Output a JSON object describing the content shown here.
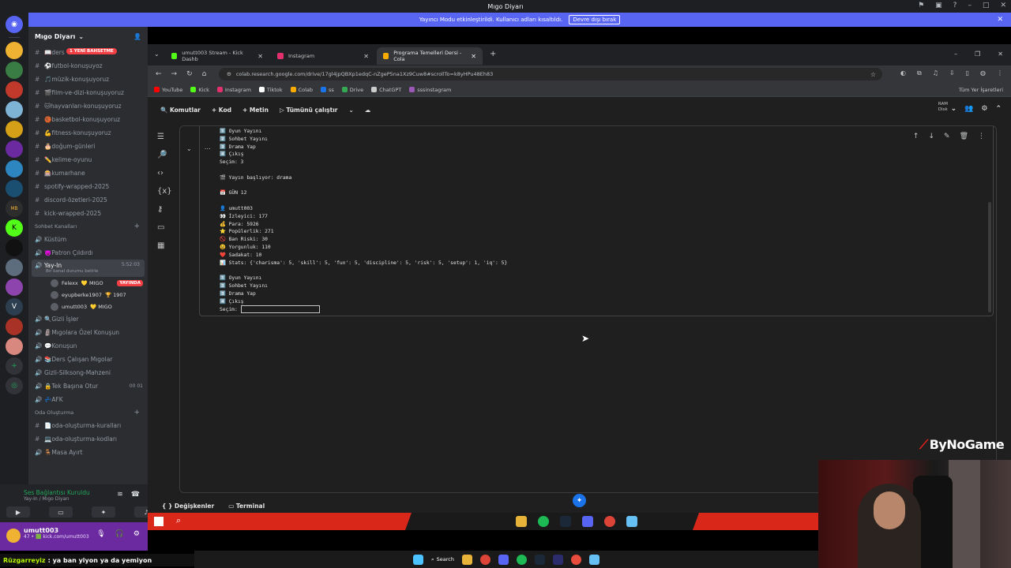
{
  "window": {
    "title": "Mıgo Diyarı"
  },
  "banner": {
    "text": "Yayıncı Modu etkinleştirildi. Kullanıcı adları kısaltıldı.",
    "button": "Devre dışı bırak"
  },
  "sidebar": {
    "server_name": "Mıgo Diyarı",
    "new_messages_badge": "1 YENİ BAHSETME",
    "channels": [
      "📖ders",
      "⚽futbol-konuşuyoz",
      "🎵müzik-konuşuyoruz",
      "🎬film-ve-dizi-konuşuyoruz",
      "🐱hayvanları-konuşuyoruz",
      "🏀basketbol-konuşuyoruz",
      "💪fitness-konuşuyoruz",
      "🎂doğum-günleri",
      "✏️kelime-oyunu",
      "🎰kumarhane",
      "spotify-wrapped-2025",
      "discord-özetleri-2025",
      "kick-wrapped-2025"
    ],
    "category_voice": "Sohbet Kanalları",
    "voice_channels_top": [
      "Küstüm",
      "👿Patron Çıldırdı"
    ],
    "active_voice": {
      "name": "Yay-In",
      "time": "5:52:03",
      "status": "Bir kanal durumu belirle"
    },
    "voice_users": [
      {
        "name": "Felexx",
        "tag": "💛 MIGO",
        "live": "YAYINDA"
      },
      {
        "name": "eyupberke1907",
        "tag": "🏆 1907",
        "live": ""
      },
      {
        "name": "umutt003",
        "tag": "💛 MIGO",
        "live": ""
      }
    ],
    "voice_channels_bottom": [
      "🔍Gizli İşler",
      "🗿Mıgolara Özel Konuşun",
      "💬Konuşun",
      "📚Ders Çalışan Mıgolar",
      "Gizli-Silksong-Mahzeni",
      "🔒Tek Başına Otur",
      "💤AFK"
    ],
    "tek_basina_count": "00",
    "tek_basina_limit": "01",
    "category_room": "Oda Oluşturma",
    "room_channels": [
      "📄oda-oluşturma-kuralları",
      "💻oda-oluşturma-kodları"
    ],
    "room_voice": "🪑Masa Ayırt"
  },
  "voice_panel": {
    "status": "Ses Bağlantısı Kuruldu",
    "location": "Yay-In / Mıgo Diyarı"
  },
  "user_panel": {
    "username": "umutt003",
    "status": "47 • 🟩 kick.com/umutt003"
  },
  "chat_overlay": {
    "name": "Rüzgarreyiz",
    "message": ": ya ban yiyon ya da yemiyon"
  },
  "browser": {
    "tabs": [
      {
        "label": "umutt003 Stream - Kick Dashb",
        "color": "#53fc18"
      },
      {
        "label": "Instagram",
        "color": "#e1306c"
      },
      {
        "label": "Programa Temelleri Dersi - Cola",
        "color": "#f9ab00"
      }
    ],
    "url": "colab.research.google.com/drive/17gl4jpQBXp1edqC-nZgeP5na1Xz9Cuw8#scrollTo=k8yHPu48Eh83",
    "bookmarks": [
      {
        "label": "YouTube",
        "color": "#ff0000"
      },
      {
        "label": "Kick",
        "color": "#53fc18"
      },
      {
        "label": "Instagram",
        "color": "#e1306c"
      },
      {
        "label": "Tiktok",
        "color": "#ffffff"
      },
      {
        "label": "Colab",
        "color": "#f9ab00"
      },
      {
        "label": "ss",
        "color": "#1a73e8"
      },
      {
        "label": "Drive",
        "color": "#34a853"
      },
      {
        "label": "ChatGPT",
        "color": "#cccccc"
      },
      {
        "label": "sssinstagram",
        "color": "#9b59b6"
      }
    ],
    "all_bookmarks": "Tüm Yer İşaretleri"
  },
  "colab": {
    "toolbar": [
      "Komutlar",
      "+ Kod",
      "+ Metin",
      "▷ Tümünü çalıştır"
    ],
    "ram": "RAM",
    "disk": "Disk",
    "output_lines": [
      "1️⃣ Oyun Yayını",
      "2️⃣ Sohbet Yayını",
      "3️⃣ Drama Yap",
      "4️⃣ Çıkış",
      "Seçim: 3",
      "",
      "🎬 Yayın başlıyor: drama",
      "",
      "📅 GÜN 12",
      "",
      "👤 umutt003",
      "👀 İzleyici: 177",
      "💰 Para: 5926",
      "⭐ Popülerlik: 271",
      "🚫 Ban Riski: 30",
      "😫 Yorgunluk: 110",
      "❤️ Sadakat: 10",
      "📊 Stats: {'charisma': 5, 'skill': 5, 'fun': 5, 'discipline': 5, 'risk': 5, 'setup': 1, 'iq': 5}",
      "",
      "1️⃣ Oyun Yayını",
      "2️⃣ Sohbet Yayını",
      "3️⃣ Drama Yap",
      "4️⃣ Çıkış"
    ],
    "prompt": "Seçim:",
    "bottom": [
      "Değişkenler",
      "Terminal"
    ]
  },
  "overlay_logo": "ByNoGame",
  "taskbar": {
    "search": "Search"
  }
}
